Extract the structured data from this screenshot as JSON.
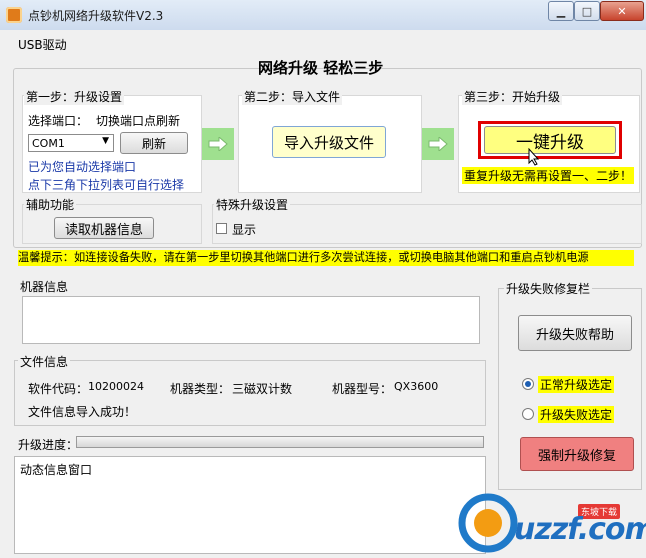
{
  "window": {
    "title": "点钞机网络升级软件V2.3"
  },
  "menu": {
    "usb": "USB驱动"
  },
  "header": {
    "title": "网络升级  轻松三步"
  },
  "step1": {
    "label": "第一步：升级设置",
    "port_label": "选择端口：",
    "refresh_hint": "切换端口点刷新",
    "port_value": "COM1",
    "refresh_button": "刷新",
    "auto_text": "已为您自动选择端口",
    "manual_text": "点下三角下拉列表可自行选择"
  },
  "step2": {
    "label": "第二步：导入文件",
    "import_button": "导入升级文件"
  },
  "step3": {
    "label": "第三步：开始升级",
    "one_key_button": "一键升级",
    "note": "重复升级无需再设置一、二步！"
  },
  "aux": {
    "label": "辅助功能",
    "read_button": "读取机器信息"
  },
  "special": {
    "label": "特殊升级设置",
    "display_label": "显示"
  },
  "tip": {
    "text": "温馨提示：如连接设备失败，请在第一步里切换其他端口进行多次尝试连接，或切换电脑其他端口和重启点钞机电源"
  },
  "machine_info": {
    "label": "机器信息"
  },
  "file_info": {
    "label": "文件信息",
    "software_code_label": "软件代码：",
    "software_code": "10200024",
    "machine_type_label": "机器类型：",
    "machine_type": "三磁双计数",
    "machine_model_label": "机器型号：",
    "machine_model": "QX3600",
    "status": "文件信息导入成功！"
  },
  "progress": {
    "label": "升级进度：",
    "value": 0
  },
  "dynamic": {
    "text": "动态信息窗口"
  },
  "repair": {
    "label": "升级失败修复栏",
    "help_button": "升级失败帮助",
    "normal_radio": "正常升级选定",
    "fail_radio": "升级失败选定",
    "force_button": "强制升级修复"
  },
  "watermark": {
    "text": "uzzf.com",
    "sub": "东坡下载"
  },
  "colors": {
    "highlight_yellow": "#ffff00",
    "red_border": "#e00000",
    "force_button": "#f08080",
    "green_arrow": "#9fe08f"
  }
}
